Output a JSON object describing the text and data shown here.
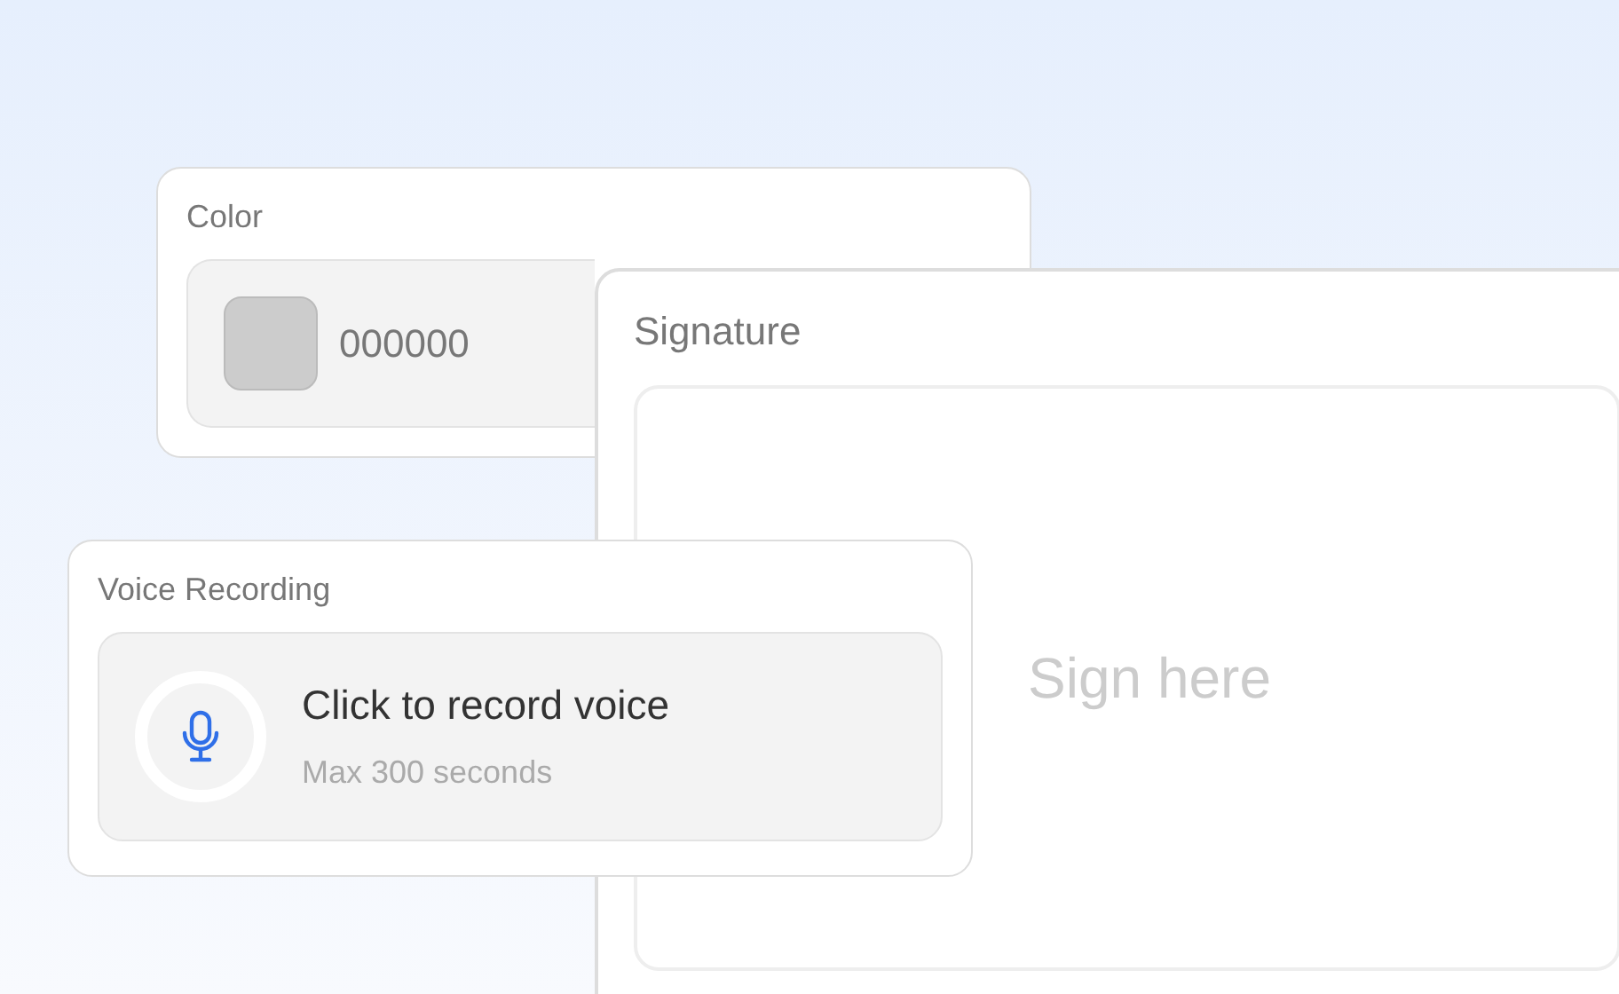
{
  "color_field": {
    "label": "Color",
    "color": "#cccccc",
    "value": "000000"
  },
  "signature_field": {
    "label": "Signature",
    "placeholder": "Sign here"
  },
  "voice_field": {
    "label": "Voice Recording",
    "prompt": "Click to record voice",
    "hint": "Max 300 seconds"
  }
}
